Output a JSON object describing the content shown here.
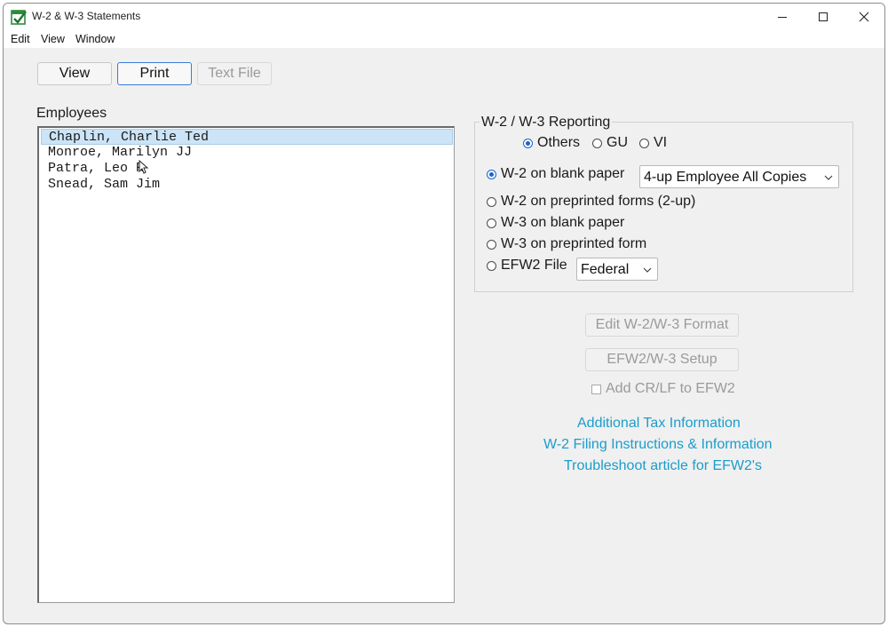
{
  "window": {
    "title": "W-2 & W-3 Statements"
  },
  "menu": [
    "Edit",
    "View",
    "Window"
  ],
  "toolbar": {
    "view_label": "View",
    "print_label": "Print",
    "textfile_label": "Text File"
  },
  "employees": {
    "label": "Employees",
    "items": [
      "Chaplin, Charlie Ted",
      "Monroe, Marilyn JJ",
      "Patra, Leo R",
      "Snead, Sam Jim"
    ],
    "selected_index": 0
  },
  "reporting": {
    "title": "W-2 / W-3 Reporting",
    "jurisdiction": {
      "options": [
        "Others",
        "GU",
        "VI"
      ],
      "selected": "Others"
    },
    "options": [
      "W-2 on blank paper",
      "W-2 on preprinted forms (2-up)",
      "W-3 on blank paper",
      "W-3 on preprinted form",
      "EFW2 File"
    ],
    "selected_option": "W-2 on blank paper",
    "blank_paper_select": "4-up Employee All Copies",
    "efw2_select": "Federal"
  },
  "actions": {
    "edit_format_label": "Edit W-2/W-3 Format",
    "efw2_setup_label": "EFW2/W-3 Setup",
    "crlf_label": "Add CR/LF to EFW2",
    "crlf_checked": false
  },
  "links": {
    "additional": "Additional Tax Information",
    "filing": "W-2 Filing Instructions & Information",
    "troubleshoot": "Troubleshoot article for EFW2's"
  },
  "colors": {
    "selection": "#cce4f7",
    "link": "#1a9dcc",
    "accent": "#1a64c8"
  }
}
